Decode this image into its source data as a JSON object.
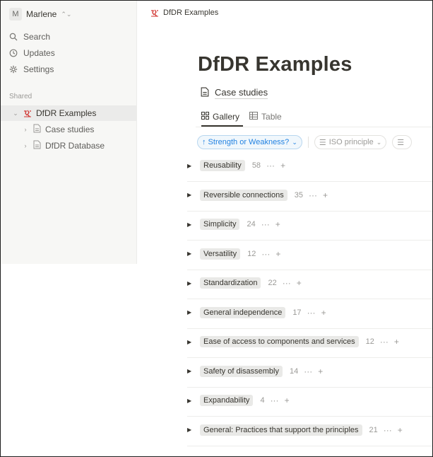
{
  "workspace": {
    "avatar_letter": "M",
    "name": "Marlene"
  },
  "sidebar": {
    "nav": [
      {
        "label": "Search",
        "icon": "search-icon"
      },
      {
        "label": "Updates",
        "icon": "clock-icon"
      },
      {
        "label": "Settings",
        "icon": "gear-icon"
      }
    ],
    "shared_label": "Shared",
    "tree": {
      "root": "DfDR Examples",
      "children": [
        "Case studies",
        "DfDR Database"
      ]
    }
  },
  "breadcrumb": {
    "label": "DfDR Examples"
  },
  "page": {
    "title": "DfDR Examples",
    "linked_db": "Case studies",
    "views": [
      "Gallery",
      "Table"
    ],
    "filters": {
      "active": "↑ Strength or Weakness?",
      "second": "ISO principle",
      "third": ""
    }
  },
  "groups": [
    {
      "name": "Reusability",
      "count": "58"
    },
    {
      "name": "Reversible connections",
      "count": "35"
    },
    {
      "name": "Simplicity",
      "count": "24"
    },
    {
      "name": "Versatility",
      "count": "12"
    },
    {
      "name": "Standardization",
      "count": "22"
    },
    {
      "name": "General independence",
      "count": "17"
    },
    {
      "name": "Ease of access to components and services",
      "count": "12"
    },
    {
      "name": "Safety of disassembly",
      "count": "14"
    },
    {
      "name": "Expandability",
      "count": "4"
    },
    {
      "name": "General: Practices that support the principles",
      "count": "21"
    }
  ],
  "colors": {
    "accent": "#2383e2",
    "sidebar_bg": "#f7f7f5",
    "tag_bg": "#e9e9e7",
    "logo": "#d0312d"
  }
}
